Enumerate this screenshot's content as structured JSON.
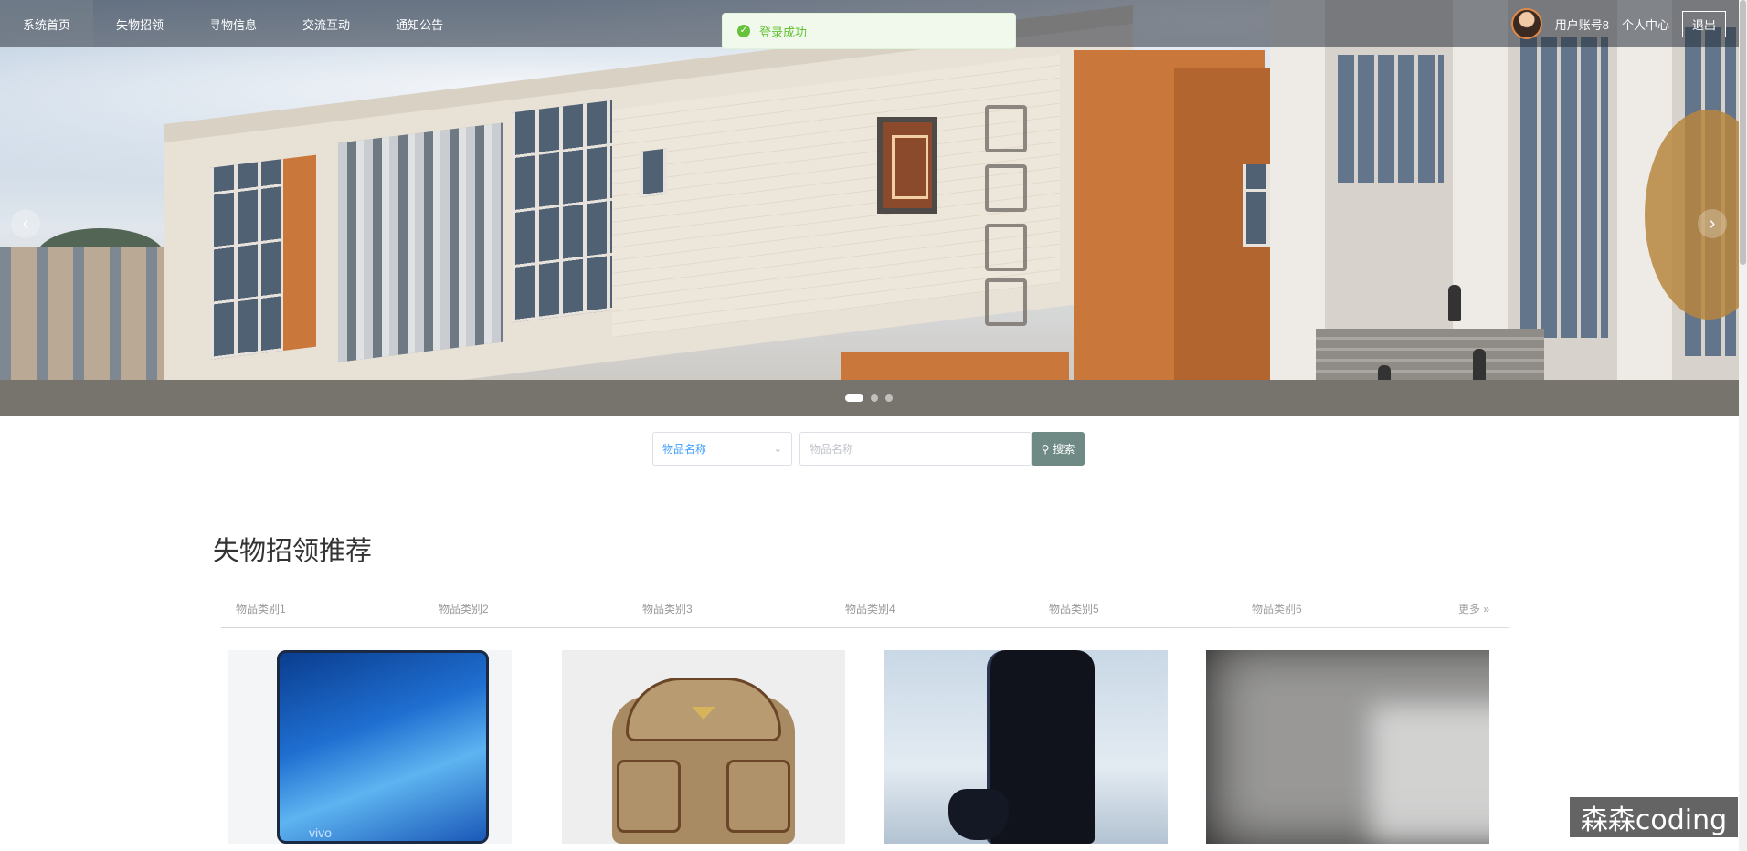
{
  "nav": {
    "items": [
      {
        "label": "系统首页",
        "active": true
      },
      {
        "label": "失物招领",
        "active": false
      },
      {
        "label": "寻物信息",
        "active": false
      },
      {
        "label": "交流互动",
        "active": false
      },
      {
        "label": "通知公告",
        "active": false
      }
    ],
    "user_label": "用户账号8",
    "profile_label": "个人中心",
    "logout_label": "退出"
  },
  "toast": {
    "message": "登录成功",
    "type": "success",
    "color": "#67c23a"
  },
  "banner": {
    "prev_icon": "chevron-left-icon",
    "next_icon": "chevron-right-icon",
    "slide_count": 3,
    "active_slide": 1
  },
  "search": {
    "field_selected": "物品名称",
    "input_placeholder": "物品名称",
    "input_value": "",
    "button_label": "搜索",
    "button_icon": "search-icon",
    "button_color": "#6f8a85"
  },
  "section": {
    "title": "失物招领推荐",
    "tabs": [
      "物品类别1",
      "物品类别2",
      "物品类别3",
      "物品类别4",
      "物品类别5",
      "物品类别6"
    ],
    "more_label": "更多 »",
    "items": [
      {
        "image": "blue smartphone",
        "image_text": "vivo"
      },
      {
        "image": "tan canvas backpack"
      },
      {
        "image": "black game console with controller"
      },
      {
        "image": "dark object"
      }
    ]
  },
  "watermark": "森森coding"
}
